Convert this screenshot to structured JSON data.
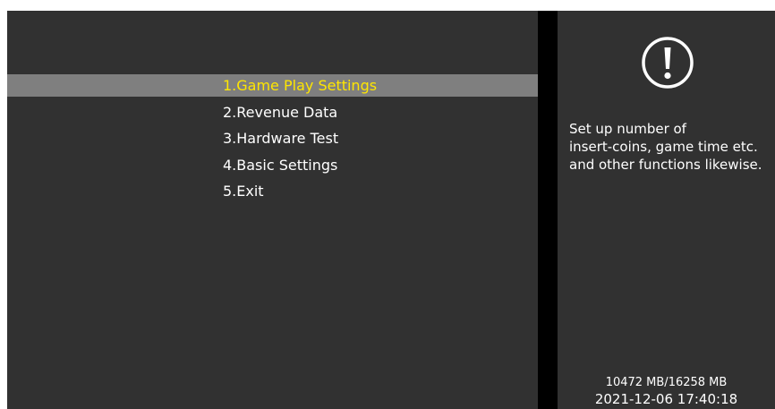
{
  "menu": {
    "items": [
      {
        "label": "1.Game Play Settings"
      },
      {
        "label": "2.Revenue Data"
      },
      {
        "label": "3.Hardware Test"
      },
      {
        "label": "4.Basic Settings"
      },
      {
        "label": "5.Exit"
      }
    ],
    "selected_index": 0
  },
  "info": {
    "icon": "exclamation-circle-icon",
    "description": "Set up number of\ninsert-coins, game time etc.\nand other functions likewise."
  },
  "status": {
    "storage": "10472 MB/16258 MB",
    "datetime": "2021-12-06 17:40:18"
  },
  "colors": {
    "background": "#313131",
    "highlight": "#7f7f7f",
    "selected_text": "#ffe600",
    "text": "#ffffff",
    "divider": "#000000"
  }
}
